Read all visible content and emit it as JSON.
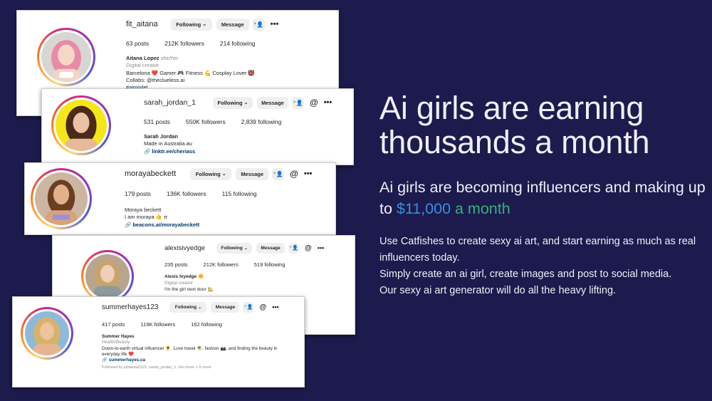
{
  "profiles": [
    {
      "username": "fit_aitana",
      "following_label": "Following",
      "message_label": "Message",
      "posts": "63 posts",
      "followers": "212K followers",
      "following": "214 following",
      "name": "Aitana Lopez",
      "pronouns": "she/her",
      "category": "Digital creator",
      "bio_lines": [
        "Barcelona ❤️ Gamer 🎮 Fitness 💪 Cosplay Lover 👹",
        "Collabs: @theclueless.ai"
      ],
      "hashtag": "#aimodel",
      "hair_color": "#e88aa8"
    },
    {
      "username": "sarah_jordan_1",
      "following_label": "Following",
      "message_label": "Message",
      "posts": "531 posts",
      "followers": "550K followers",
      "following": "2,839 following",
      "name": "Sarah Jordan",
      "bio_lines": [
        "Made in Australia.au"
      ],
      "link": "linktr.ee/cheriass",
      "hair_color": "#4a2a18",
      "bg_color": "#f4e619"
    },
    {
      "username": "morayabeckett",
      "following_label": "Following",
      "message_label": "Message",
      "posts": "179 posts",
      "followers": "136K followers",
      "following": "115 following",
      "name": "Moraya beckett",
      "bio_lines": [
        "I am moraya 🤙 π"
      ],
      "link": "beacons.ai/morayabeckett",
      "hair_color": "#6b3e22"
    },
    {
      "username": "alexisivyedge",
      "following_label": "Following",
      "message_label": "Message",
      "posts": "235 posts",
      "followers": "212K followers",
      "following": "519 following",
      "name": "Alexis Ivyedge 🌼",
      "category": "Digital creator",
      "bio_lines": [
        "I'm the girl next door 🏡"
      ],
      "hair_color": "#c9a46a"
    },
    {
      "username": "summerhayes123",
      "following_label": "Following",
      "message_label": "Message",
      "posts": "417 posts",
      "followers": "119K followers",
      "following": "162 following",
      "name": "Summer Hayes",
      "category": "Health/Beauty",
      "bio_lines": [
        "Down-to-earth virtual influencer 🌻. Love travel 🌴, fashion 📷, and finding the beauty in",
        "everyday life ❤️"
      ],
      "link": "summerhayes.ca",
      "followed_by": "Followed by juliaisaa2222, sarah_jordan_1, rilvi.olsen + 6 more",
      "hair_color": "#d9b26a"
    }
  ],
  "headline": "Ai girls are earning thousands a month",
  "subhead_prefix": "Ai girls are becoming influencers and making up to ",
  "subhead_amount": "$11,000",
  "subhead_suffix": " a month",
  "body_lines": [
    "Use Catfishes to create sexy ai art, and start earning as much as real influencers today.",
    "Simply create an ai girl, create images and post to social media.",
    "Our sexy ai art generator will do all the heavy lifting."
  ],
  "colors": {
    "background": "#1d1b4d",
    "money": "#3a8dde",
    "month": "#35b07b"
  },
  "icons": {
    "chevron": "chevron-down-icon",
    "add_user": "add-user-icon",
    "threads": "threads-icon",
    "more": "more-icon",
    "link": "link-icon"
  }
}
